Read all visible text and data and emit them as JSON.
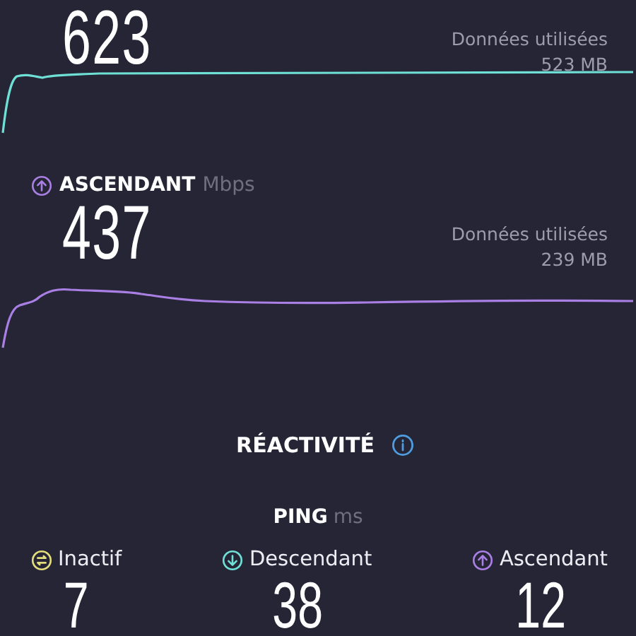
{
  "download": {
    "speed": "623",
    "data_label": "Données utilisées",
    "data_value": "523 MB"
  },
  "upload": {
    "title": "ASCENDANT",
    "unit": "Mbps",
    "speed": "437",
    "data_label": "Données utilisées",
    "data_value": "239 MB"
  },
  "responsiveness": {
    "title": "RÉACTIVITÉ"
  },
  "ping": {
    "title": "PING",
    "unit": "ms",
    "items": [
      {
        "kind": "idle",
        "label": "Inactif",
        "value": "7",
        "color": "#e3de7c"
      },
      {
        "kind": "download",
        "label": "Descendant",
        "value": "38",
        "color": "#6fe0d6"
      },
      {
        "kind": "upload",
        "label": "Ascendant",
        "value": "12",
        "color": "#a97fe4"
      }
    ]
  }
}
